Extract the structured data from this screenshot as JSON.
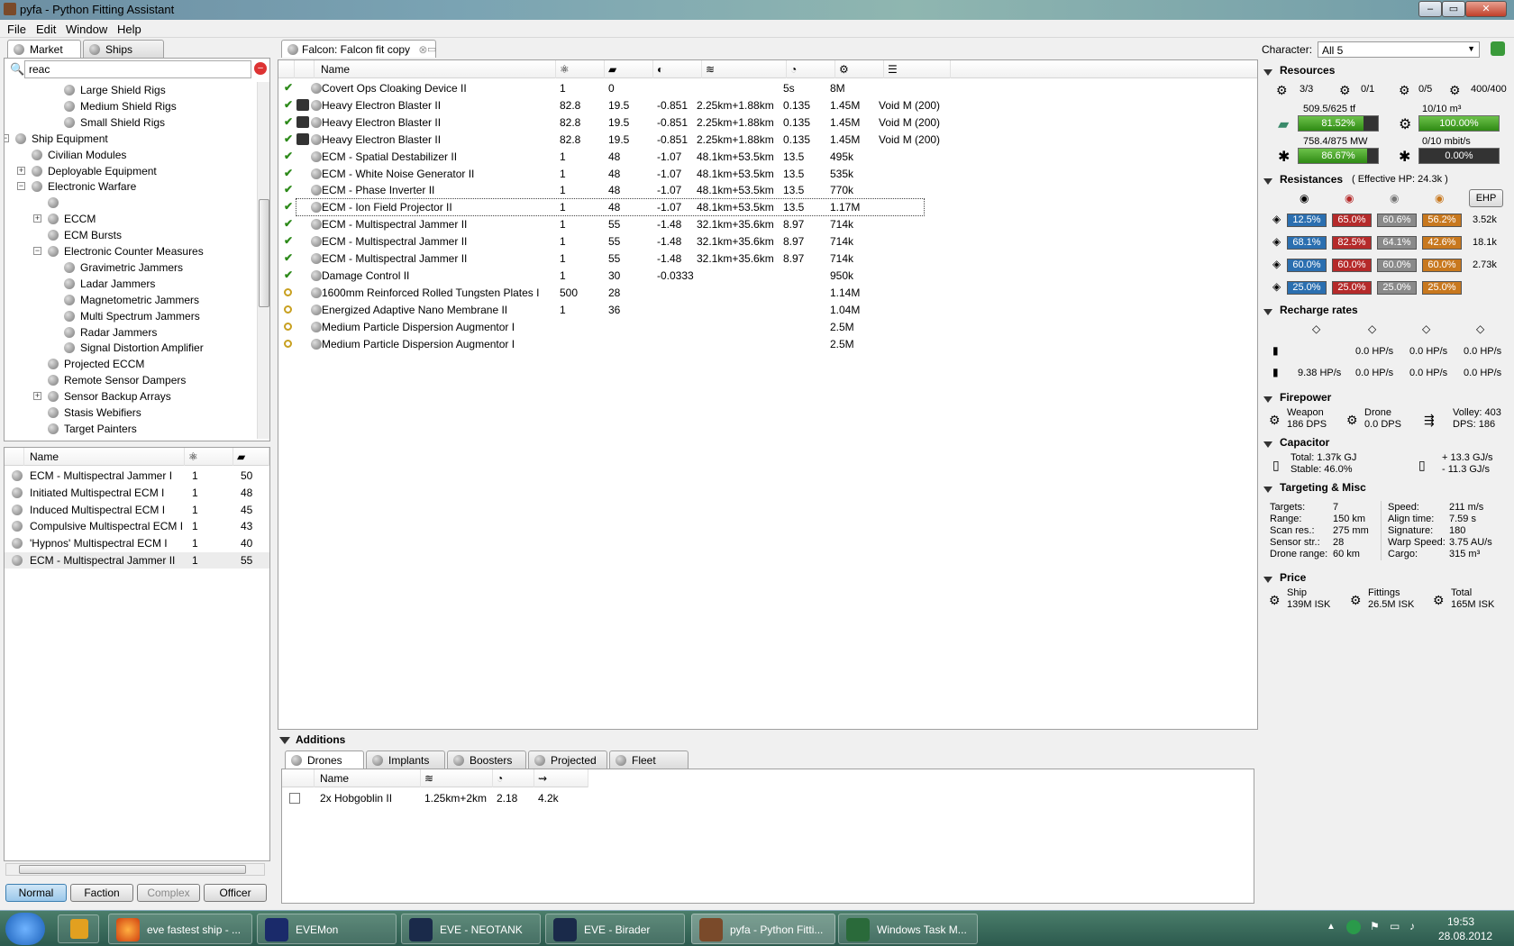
{
  "window": {
    "title": "pyfa - Python Fitting Assistant"
  },
  "menu": [
    "File",
    "Edit",
    "Window",
    "Help"
  ],
  "left": {
    "tabs": [
      "Market",
      "Ships"
    ],
    "search_value": "reac",
    "tree": [
      {
        "label": "Large Shield Rigs"
      },
      {
        "label": "Medium Shield Rigs"
      },
      {
        "label": "Small Shield Rigs"
      },
      {
        "label": "Ship Equipment"
      },
      {
        "label": "Civilian Modules"
      },
      {
        "label": "Deployable Equipment"
      },
      {
        "label": "Electronic Warfare"
      },
      {
        "label": ""
      },
      {
        "label": "ECCM"
      },
      {
        "label": "ECM Bursts"
      },
      {
        "label": "Electronic Counter Measures"
      },
      {
        "label": "Gravimetric Jammers"
      },
      {
        "label": "Ladar Jammers"
      },
      {
        "label": "Magnetometric Jammers"
      },
      {
        "label": "Multi Spectrum Jammers"
      },
      {
        "label": "Radar Jammers"
      },
      {
        "label": "Signal Distortion Amplifier"
      },
      {
        "label": "Projected ECCM"
      },
      {
        "label": "Remote Sensor Dampers"
      },
      {
        "label": "Sensor Backup Arrays"
      },
      {
        "label": "Stasis Webifiers"
      },
      {
        "label": "Target Painters"
      }
    ],
    "list_header": "Name",
    "list": [
      {
        "name": "ECM - Multispectral Jammer I",
        "a": "1",
        "b": "50"
      },
      {
        "name": "Initiated Multispectral ECM I",
        "a": "1",
        "b": "48"
      },
      {
        "name": "Induced Multispectral ECM I",
        "a": "1",
        "b": "45"
      },
      {
        "name": "Compulsive Multispectral ECM I",
        "a": "1",
        "b": "43"
      },
      {
        "name": "'Hypnos' Multispectral ECM I",
        "a": "1",
        "b": "40"
      },
      {
        "name": "ECM - Multispectral Jammer II",
        "a": "1",
        "b": "55"
      }
    ],
    "meta_buttons": [
      "Normal",
      "Faction",
      "Complex",
      "Officer"
    ]
  },
  "fit": {
    "tab": "Falcon: Falcon fit copy",
    "header": "Name",
    "rows": [
      {
        "name": "Covert Ops Cloaking Device II",
        "c1": "1",
        "c2": "0",
        "c3": "",
        "c4": "",
        "c5": "5s",
        "c6": "8M",
        "c7": ""
      },
      {
        "name": "Heavy Electron Blaster II",
        "c1": "82.8",
        "c2": "19.5",
        "c3": "-0.851",
        "c4": "2.25km+1.88km",
        "c5": "0.135",
        "c6": "1.45M",
        "c7": "Void M (200)"
      },
      {
        "name": "Heavy Electron Blaster II",
        "c1": "82.8",
        "c2": "19.5",
        "c3": "-0.851",
        "c4": "2.25km+1.88km",
        "c5": "0.135",
        "c6": "1.45M",
        "c7": "Void M (200)"
      },
      {
        "name": "Heavy Electron Blaster II",
        "c1": "82.8",
        "c2": "19.5",
        "c3": "-0.851",
        "c4": "2.25km+1.88km",
        "c5": "0.135",
        "c6": "1.45M",
        "c7": "Void M (200)"
      },
      {
        "name": "ECM - Spatial Destabilizer II",
        "c1": "1",
        "c2": "48",
        "c3": "-1.07",
        "c4": "48.1km+53.5km",
        "c5": "13.5",
        "c6": "495k",
        "c7": ""
      },
      {
        "name": "ECM - White Noise Generator II",
        "c1": "1",
        "c2": "48",
        "c3": "-1.07",
        "c4": "48.1km+53.5km",
        "c5": "13.5",
        "c6": "535k",
        "c7": ""
      },
      {
        "name": "ECM - Phase Inverter II",
        "c1": "1",
        "c2": "48",
        "c3": "-1.07",
        "c4": "48.1km+53.5km",
        "c5": "13.5",
        "c6": "770k",
        "c7": ""
      },
      {
        "name": "ECM - Ion Field Projector II",
        "c1": "1",
        "c2": "48",
        "c3": "-1.07",
        "c4": "48.1km+53.5km",
        "c5": "13.5",
        "c6": "1.17M",
        "c7": ""
      },
      {
        "name": "ECM - Multispectral Jammer II",
        "c1": "1",
        "c2": "55",
        "c3": "-1.48",
        "c4": "32.1km+35.6km",
        "c5": "8.97",
        "c6": "714k",
        "c7": ""
      },
      {
        "name": "ECM - Multispectral Jammer II",
        "c1": "1",
        "c2": "55",
        "c3": "-1.48",
        "c4": "32.1km+35.6km",
        "c5": "8.97",
        "c6": "714k",
        "c7": ""
      },
      {
        "name": "ECM - Multispectral Jammer II",
        "c1": "1",
        "c2": "55",
        "c3": "-1.48",
        "c4": "32.1km+35.6km",
        "c5": "8.97",
        "c6": "714k",
        "c7": ""
      },
      {
        "name": "Damage Control II",
        "c1": "1",
        "c2": "30",
        "c3": "-0.0333",
        "c4": "",
        "c5": "",
        "c6": "950k",
        "c7": ""
      },
      {
        "name": "1600mm Reinforced Rolled Tungsten Plates I",
        "c1": "500",
        "c2": "28",
        "c3": "",
        "c4": "",
        "c5": "",
        "c6": "1.14M",
        "c7": ""
      },
      {
        "name": "Energized Adaptive Nano Membrane II",
        "c1": "1",
        "c2": "36",
        "c3": "",
        "c4": "",
        "c5": "",
        "c6": "1.04M",
        "c7": ""
      },
      {
        "name": "Medium Particle Dispersion Augmentor I",
        "c1": "",
        "c2": "",
        "c3": "",
        "c4": "",
        "c5": "",
        "c6": "2.5M",
        "c7": ""
      },
      {
        "name": "Medium Particle Dispersion Augmentor I",
        "c1": "",
        "c2": "",
        "c3": "",
        "c4": "",
        "c5": "",
        "c6": "2.5M",
        "c7": ""
      }
    ]
  },
  "additions": {
    "title": "Additions",
    "tabs": [
      "Drones",
      "Implants",
      "Boosters",
      "Projected",
      "Fleet"
    ],
    "header": "Name",
    "drones": [
      {
        "name": "2x Hobgoblin II",
        "range": "1.25km+2km",
        "speed": "2.18",
        "dmg": "4.2k"
      }
    ]
  },
  "stats": {
    "character_label": "Character:",
    "character_value": "All 5",
    "resources_title": "Resources",
    "hardpoints": [
      "3/3",
      "0/1",
      "0/5",
      "400/400"
    ],
    "cpu_text": "509.5/625 tf",
    "cpu_pct": "81.52%",
    "cpu_frac": 0.8152,
    "bay_text": "10/10 m³",
    "bay_pct": "100.00%",
    "bay_frac": 1.0,
    "pg_text": "758.4/875 MW",
    "pg_pct": "86.67%",
    "pg_frac": 0.8667,
    "bw_text": "0/10 mbit/s",
    "bw_pct": "0.00%",
    "bw_frac": 0.0,
    "resist_title": "Resistances",
    "ehp_total": "( Effective HP: 24.3k )",
    "ehp_button": "EHP",
    "resist_rows": [
      {
        "vals": [
          "12.5%",
          "65.0%",
          "60.6%",
          "56.2%"
        ],
        "ehp": "3.52k"
      },
      {
        "vals": [
          "68.1%",
          "82.5%",
          "64.1%",
          "42.6%"
        ],
        "ehp": "18.1k"
      },
      {
        "vals": [
          "60.0%",
          "60.0%",
          "60.0%",
          "60.0%"
        ],
        "ehp": "2.73k"
      },
      {
        "vals": [
          "25.0%",
          "25.0%",
          "25.0%",
          "25.0%"
        ],
        "ehp": ""
      }
    ],
    "recharge_title": "Recharge rates",
    "recharge": [
      [
        "",
        "0.0 HP/s",
        "0.0 HP/s",
        "0.0 HP/s"
      ],
      [
        "9.38 HP/s",
        "0.0 HP/s",
        "0.0 HP/s",
        "0.0 HP/s"
      ]
    ],
    "firepower_title": "Firepower",
    "weapon_label": "Weapon",
    "weapon_dps": "186 DPS",
    "drone_label": "Drone",
    "drone_dps": "0.0 DPS",
    "volley": "Volley: 403",
    "dps": "DPS: 186",
    "capacitor_title": "Capacitor",
    "cap_total": "Total: 1.37k GJ",
    "cap_stable": "Stable: 46.0%",
    "cap_plus": "+ 13.3 GJ/s",
    "cap_minus": "- 11.3 GJ/s",
    "targeting_title": "Targeting & Misc",
    "targeting_left": [
      [
        "Targets:",
        "7"
      ],
      [
        "Range:",
        "150 km"
      ],
      [
        "Scan res.:",
        "275 mm"
      ],
      [
        "Sensor str.:",
        "28"
      ],
      [
        "Drone range:",
        "60 km"
      ]
    ],
    "targeting_right": [
      [
        "Speed:",
        "211 m/s"
      ],
      [
        "Align time:",
        "7.59 s"
      ],
      [
        "Signature:",
        "180"
      ],
      [
        "Warp Speed:",
        "3.75 AU/s"
      ],
      [
        "Cargo:",
        "315 m³"
      ]
    ],
    "price_title": "Price",
    "price_ship_label": "Ship",
    "price_ship": "139M ISK",
    "price_fit_label": "Fittings",
    "price_fit": "26.5M ISK",
    "price_total_label": "Total",
    "price_total": "165M ISK"
  },
  "taskbar": {
    "items": [
      "eve fastest ship - ...",
      "EVEMon",
      "EVE - NEOTANK",
      "EVE - Birader",
      "pyfa - Python Fitti...",
      "Windows Task M..."
    ],
    "time": "19:53",
    "date": "28.08.2012"
  },
  "colors": {
    "blue": "#2b6fb0",
    "red": "#b52a2a",
    "gray": "#8a8a8a",
    "orange": "#c8781e",
    "green": "#3c9a1c",
    "dark": "#333333"
  }
}
